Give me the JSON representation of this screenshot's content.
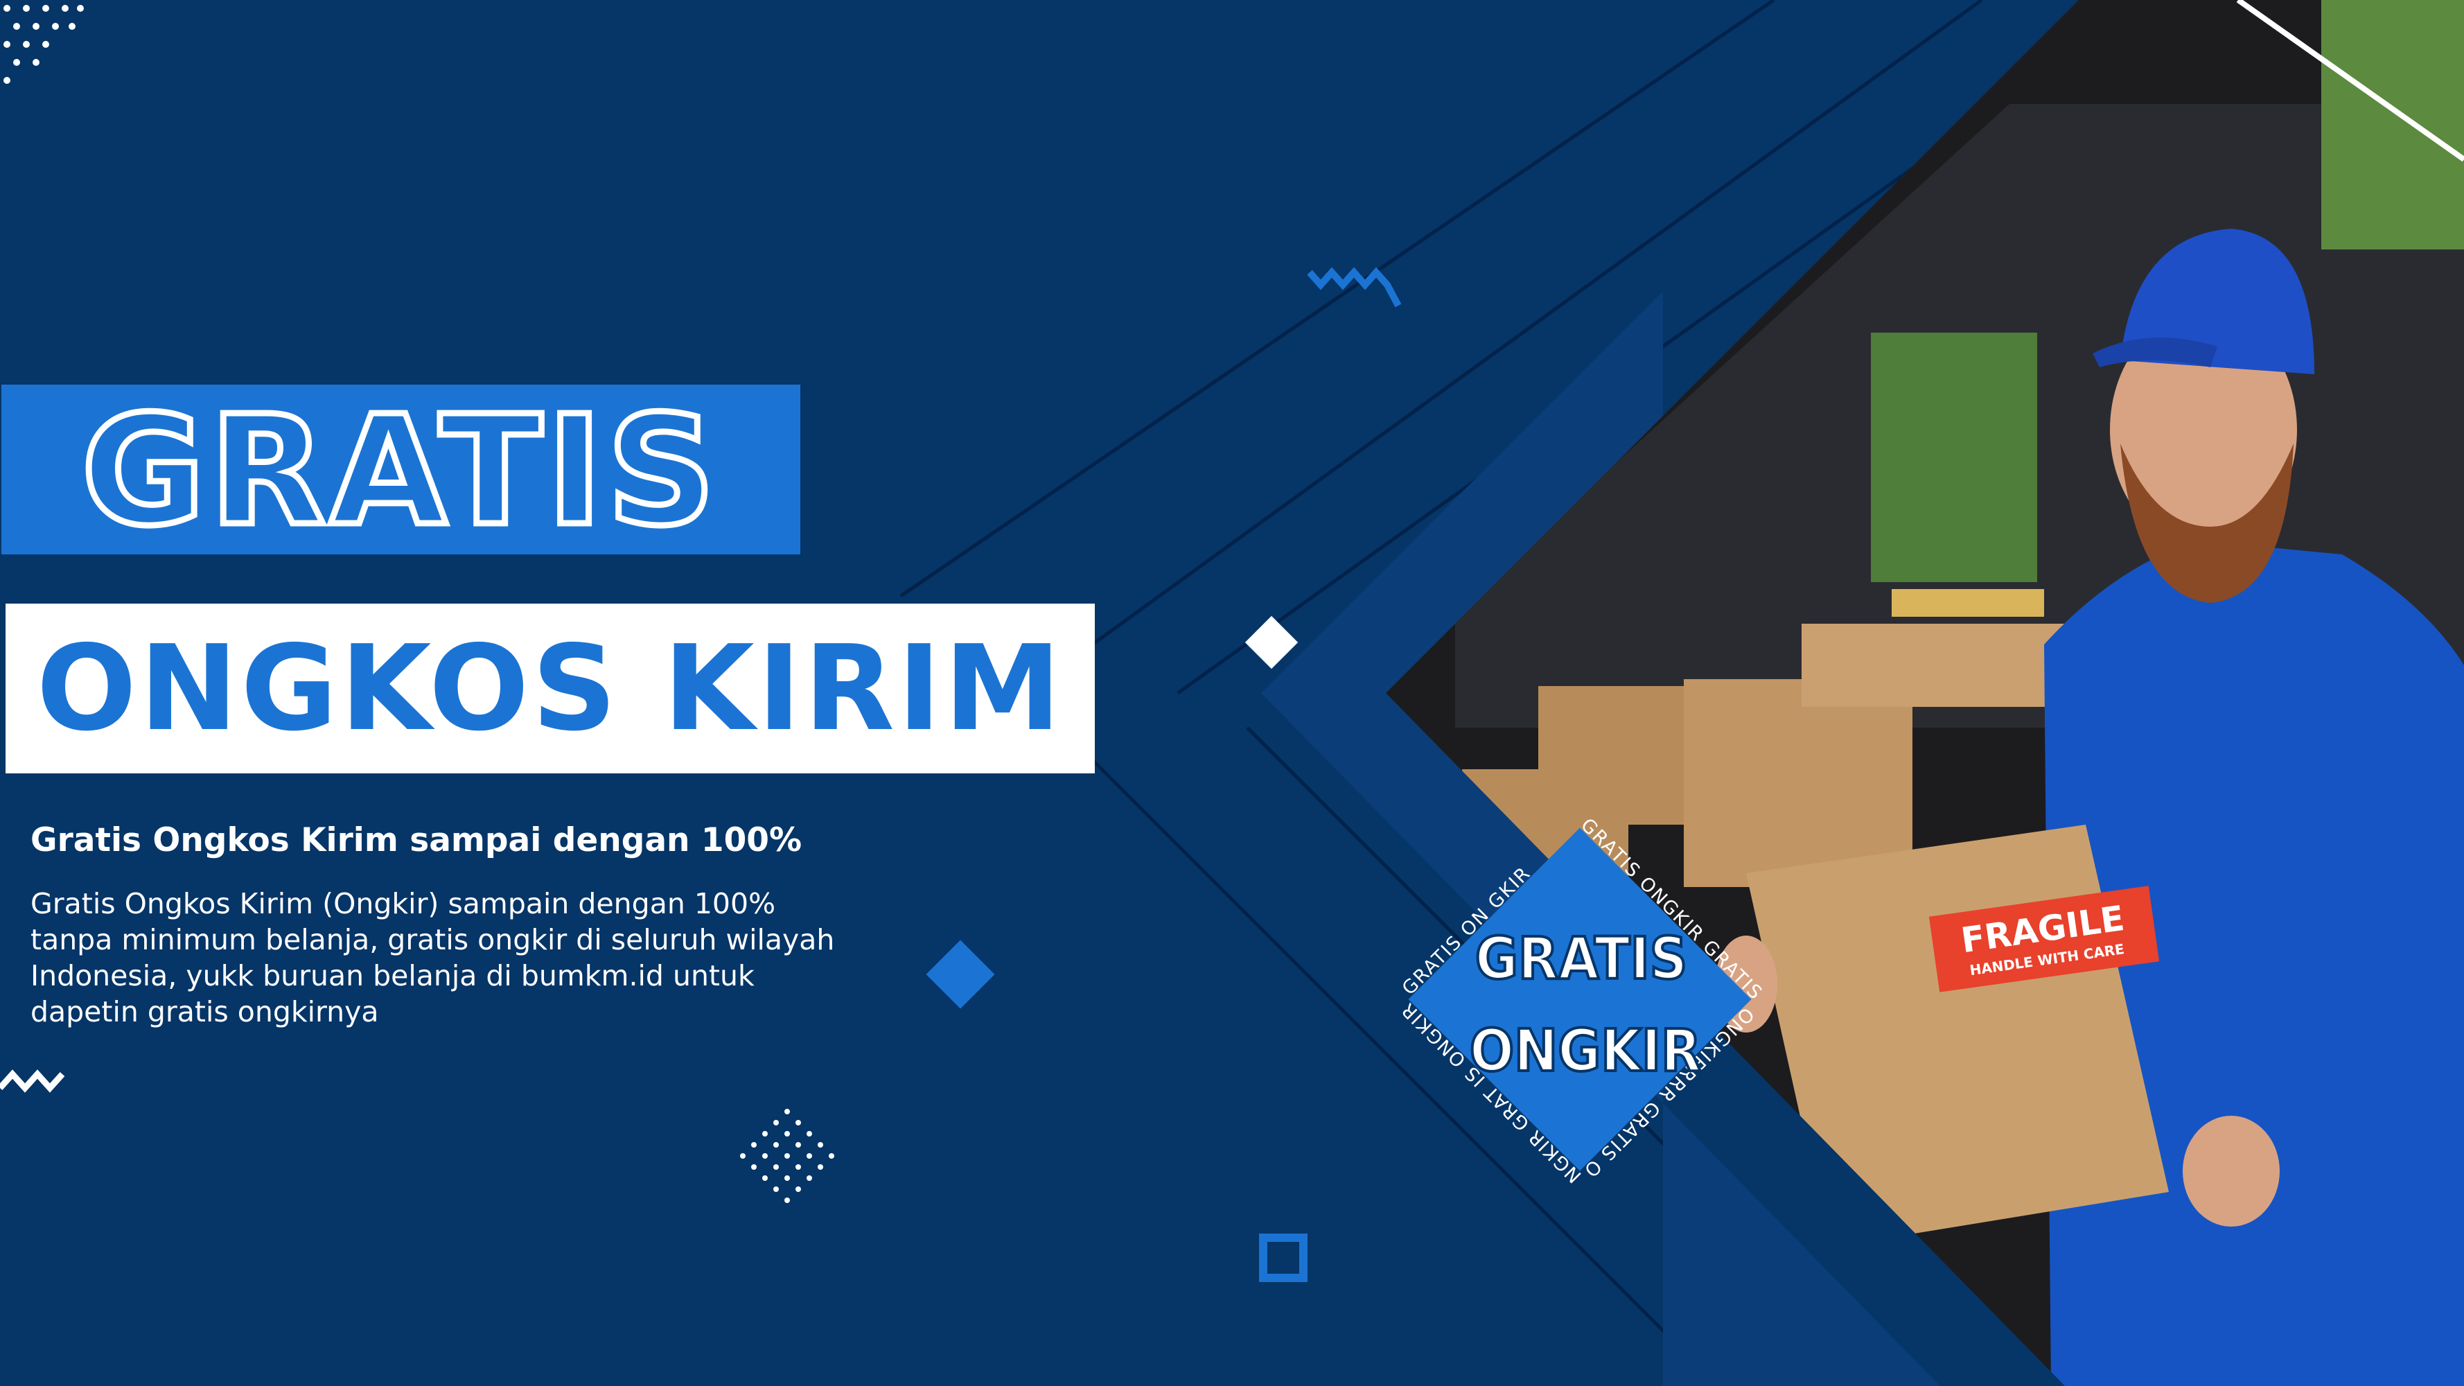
{
  "headline": {
    "line1": "GRATIS",
    "line2": "ONGKOS KIRIM"
  },
  "subtitle": "Gratis Ongkos Kirim sampai dengan 100%",
  "description_lines": [
    "Gratis Ongkos Kirim (Ongkir) sampain dengan 100%",
    "tanpa minimum belanja, gratis ongkir di seluruh wilayah",
    "Indonesia, yukk buruan belanja di bumkm.id untuk",
    "dapetin gratis ongkirnya"
  ],
  "badge": {
    "line1": "GRATIS",
    "line2": "ONGKIR",
    "ring_text": "GRATIS ONGKIR GRATIS ONGKIRRRR GRATIS ONGKIR GRAT IS ONGKIR GRATIS ON GKIR"
  },
  "box_label": {
    "line1": "FRAGILE",
    "line2": "HANDLE WITH CARE"
  },
  "colors": {
    "background": "#063567",
    "accent_blue": "#1b74d4",
    "white": "#ffffff",
    "label_red": "#e8412c"
  }
}
